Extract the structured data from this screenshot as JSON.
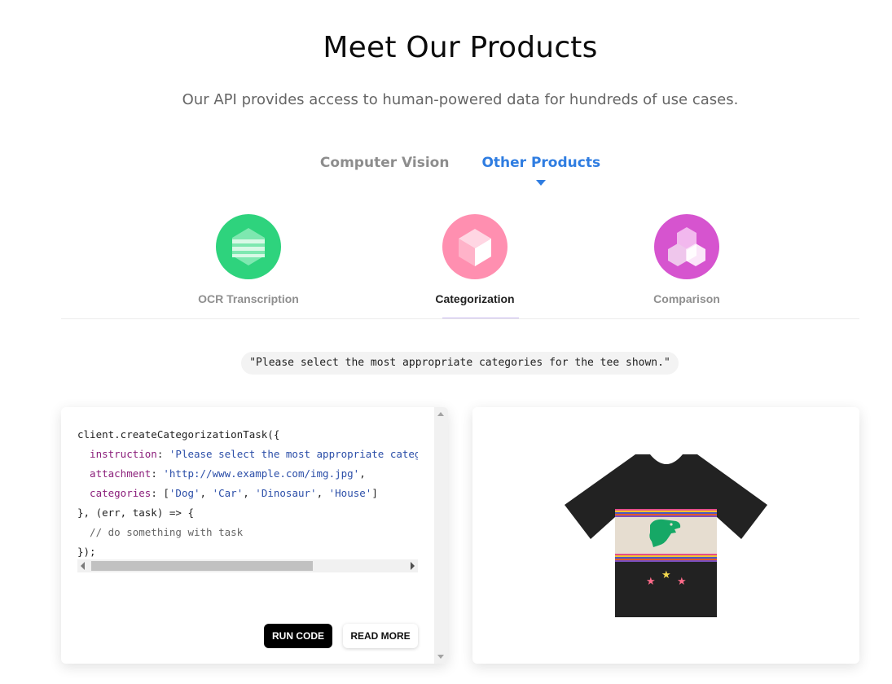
{
  "header": {
    "title": "Meet Our Products",
    "subtitle": "Our API provides access to human-powered data for hundreds of use cases."
  },
  "tabs": [
    {
      "label": "Computer Vision",
      "active": false
    },
    {
      "label": "Other Products",
      "active": true
    }
  ],
  "products": [
    {
      "label": "OCR Transcription",
      "color": "#2ed37d",
      "icon": "stack-hexagon-icon",
      "active": false
    },
    {
      "label": "Categorization",
      "color": "#ff8fb0",
      "icon": "cube-hexagon-icon",
      "active": true
    },
    {
      "label": "Comparison",
      "color": "#d654cf",
      "icon": "cubes-icon",
      "active": false
    }
  ],
  "instruction": "\"Please select the most appropriate categories for the tee shown.\"",
  "code": {
    "lines": [
      "client.createCategorizationTask({",
      "  instruction: 'Please select the most appropriate categor",
      "  attachment: 'http://www.example.com/img.jpg',",
      "  categories: ['Dog', 'Car', 'Dinosaur', 'House']",
      "}, (err, task) => {",
      "  // do something with task",
      "});"
    ]
  },
  "buttons": {
    "run": "RUN CODE",
    "more": "READ MORE"
  },
  "image": {
    "subject": "black t-shirt with green dinosaur and stars",
    "colors": {
      "shirt": "#222222",
      "dino": "#16a866",
      "panel": "#e6ddd0"
    }
  }
}
